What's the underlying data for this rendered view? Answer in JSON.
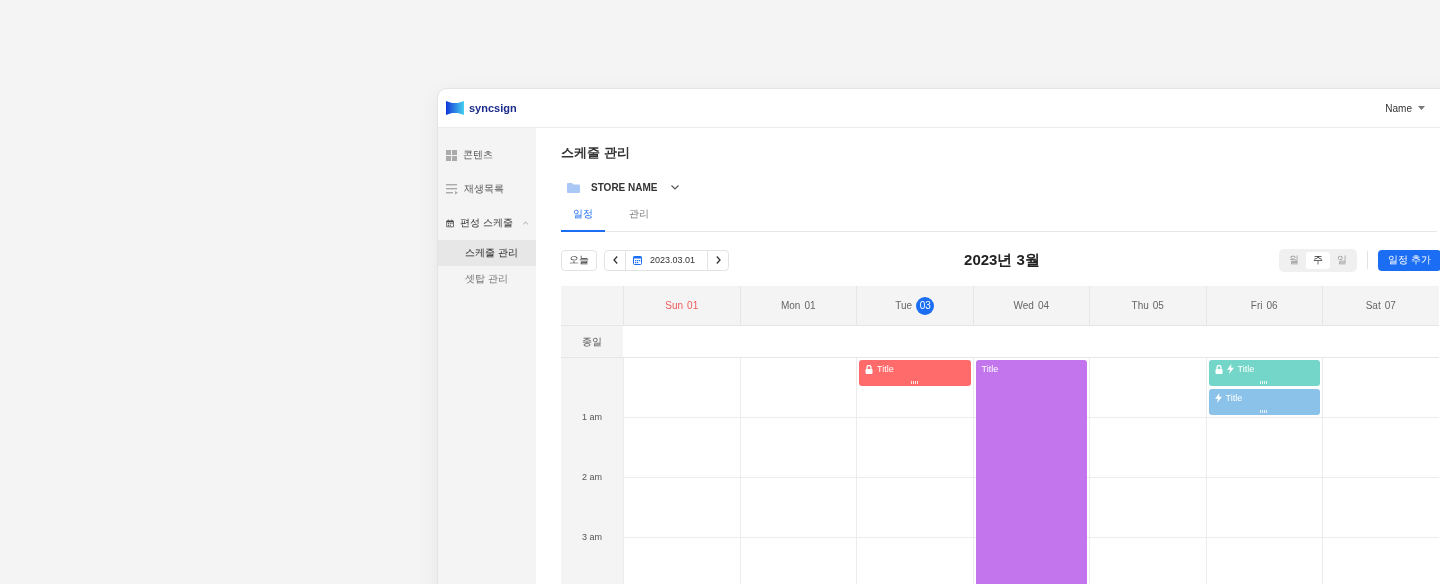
{
  "header": {
    "logo": "syncsign",
    "user": "Name"
  },
  "sidebar": {
    "items": [
      {
        "label": "콘텐츠",
        "expanded": false
      },
      {
        "label": "재생목록",
        "expanded": false
      },
      {
        "label": "편성 스케줄",
        "expanded": true,
        "children": [
          {
            "label": "스케줄 관리",
            "selected": true
          },
          {
            "label": "셋탑 관리",
            "selected": false
          }
        ]
      }
    ]
  },
  "page": {
    "title": "스케줄 관리",
    "store": "STORE NAME",
    "tabs": [
      {
        "label": "일정",
        "selected": true
      },
      {
        "label": "관리",
        "selected": false
      }
    ]
  },
  "toolbar": {
    "today": "오늘",
    "date": "2023.03.01",
    "month_title": "2023년 3월",
    "views": [
      {
        "label": "월",
        "selected": false
      },
      {
        "label": "주",
        "selected": true
      },
      {
        "label": "일",
        "selected": false
      }
    ],
    "add_button": "일정 추가"
  },
  "calendar": {
    "all_day_label": "종일",
    "times": [
      "1 am",
      "2 am",
      "3 am"
    ],
    "days": [
      {
        "weekday": "Sun",
        "date": "01",
        "sunday": true,
        "selected": false
      },
      {
        "weekday": "Mon",
        "date": "01",
        "sunday": false,
        "selected": false
      },
      {
        "weekday": "Tue",
        "date": "03",
        "sunday": false,
        "selected": true,
        "events": [
          {
            "title": "Title",
            "kind": "short",
            "locked": true,
            "bolt": false,
            "color": "#ff6b6b"
          }
        ]
      },
      {
        "weekday": "Wed",
        "date": "04",
        "sunday": false,
        "selected": false,
        "events": [
          {
            "title": "Title",
            "kind": "long",
            "locked": false,
            "bolt": false,
            "color": "#c275ec"
          }
        ]
      },
      {
        "weekday": "Thu",
        "date": "05",
        "sunday": false,
        "selected": false
      },
      {
        "weekday": "Fri",
        "date": "06",
        "sunday": false,
        "selected": false,
        "events": [
          {
            "title": "Title",
            "kind": "short",
            "locked": true,
            "bolt": true,
            "color": "#74d6c8"
          },
          {
            "title": "Title",
            "kind": "short",
            "locked": false,
            "bolt": true,
            "color": "#8bc2ea"
          }
        ]
      },
      {
        "weekday": "Sat",
        "date": "07",
        "sunday": false,
        "selected": false
      }
    ]
  }
}
